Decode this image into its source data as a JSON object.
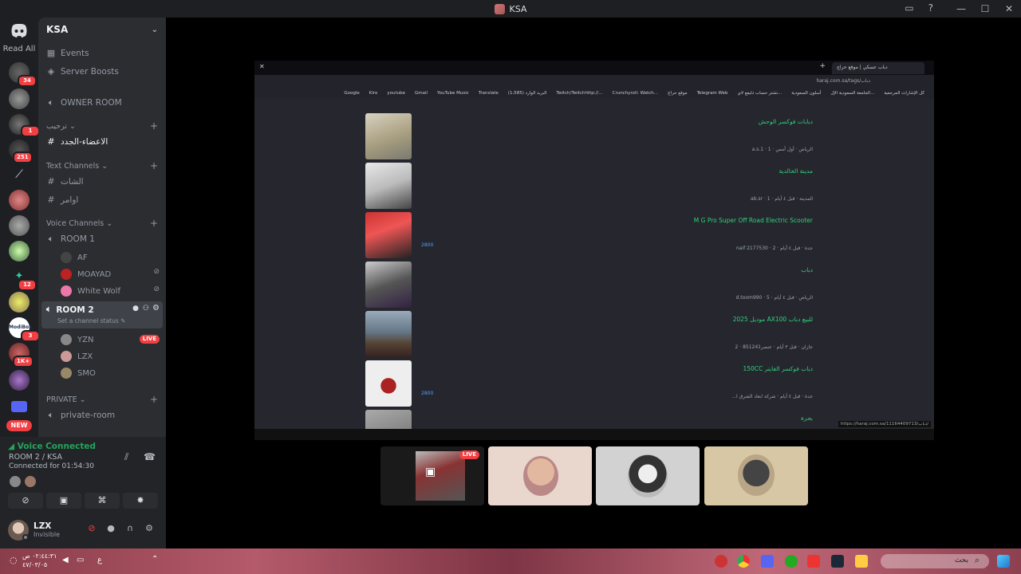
{
  "window": {
    "title": "KSA"
  },
  "rail": {
    "read_all": "Read All",
    "badges": [
      "34",
      "1",
      "251",
      "12",
      "3",
      "1K+"
    ],
    "new_label": "NEW"
  },
  "guild": {
    "name": "KSA",
    "events": "Events",
    "boosts": "Server Boosts",
    "owner_room": "OWNER ROOM",
    "cat_welcome": "ترحيب",
    "ch_new_members": "الاعضاء-الجدد",
    "cat_text": "Text Channels",
    "ch_chat": "الشات",
    "ch_commands": "اوامر",
    "cat_voice": "Voice Channels",
    "room1": "ROOM 1",
    "room1_users": [
      "AF",
      "MOAYAD",
      "White Wolf"
    ],
    "room2": "ROOM 2",
    "room2_status": "Set a channel status",
    "room2_users": [
      "YZN",
      "LZX",
      "SMO"
    ],
    "live": "LIVE",
    "cat_private": "PRIVATE",
    "private_room": "private-room"
  },
  "voice": {
    "status": "Voice Connected",
    "room": "ROOM 2 / KSA",
    "connected_for": "Connected for 01:54:30"
  },
  "user": {
    "name": "LZX",
    "status": "Invisible"
  },
  "browser": {
    "tab_title": "دباب عسكي | موقع حراج",
    "url": "haraj.com.sa/tags/دباب",
    "bookmarks": [
      "Google",
      "Kiro",
      "youtube",
      "Gmail",
      "YouTube Music",
      "Translate",
      "البريد الوارد (1،585)",
      "Twitch/Twitchhttp://...",
      "Crunchyroll: Watch...",
      "موقع حراج",
      "Telegram Web",
      "تشتر حساب دليفع لاي...",
      "أسلون السعودية",
      "الجامعة السعودية الإل...",
      "كل الإشارات المرجعية"
    ],
    "status_url": "https://haraj.com.sa/11164409713/دباب/"
  },
  "listings": [
    {
      "title": "دبابات فوكسر الوحش",
      "meta": "الرياض · أول أمس · a.s.1 · 1",
      "price": ""
    },
    {
      "title": "مدينة الخالدية",
      "meta": "المدينة · قبل ٤ أيام · ab.sr · 1",
      "price": ""
    },
    {
      "title": "M G Pro Super Off Road Electric Scooter",
      "meta": "جدة · قبل ٤ أيام · naif 2177530 · 2",
      "price": "2800"
    },
    {
      "title": "دباب",
      "meta": "الرياض · قبل ٤ أيام · d.toom990 · 5",
      "price": ""
    },
    {
      "title": "للبيع دباب AX100 موديل 2025",
      "meta": "جازان · قبل ٣ أيام · عنصر851241 · 2",
      "price": ""
    },
    {
      "title": "دباب فوكسر الفايتر 150CC",
      "meta": "جدة · قبل ٤ أيام · شركة ابعاد الشرق ا...",
      "price": "2800"
    },
    {
      "title": "بحرة",
      "meta": "",
      "price": ""
    }
  ],
  "tiles": {
    "live": "LIVE"
  },
  "taskbar": {
    "clock_time": "٠٢:٤٤:٣١ ص",
    "clock_date": "٤٧/٠٣/٠٥",
    "search": "بحث"
  },
  "colors": {
    "accent_green": "#23a55a",
    "live_red": "#f23f43",
    "listing_green": "#2fd27a"
  }
}
